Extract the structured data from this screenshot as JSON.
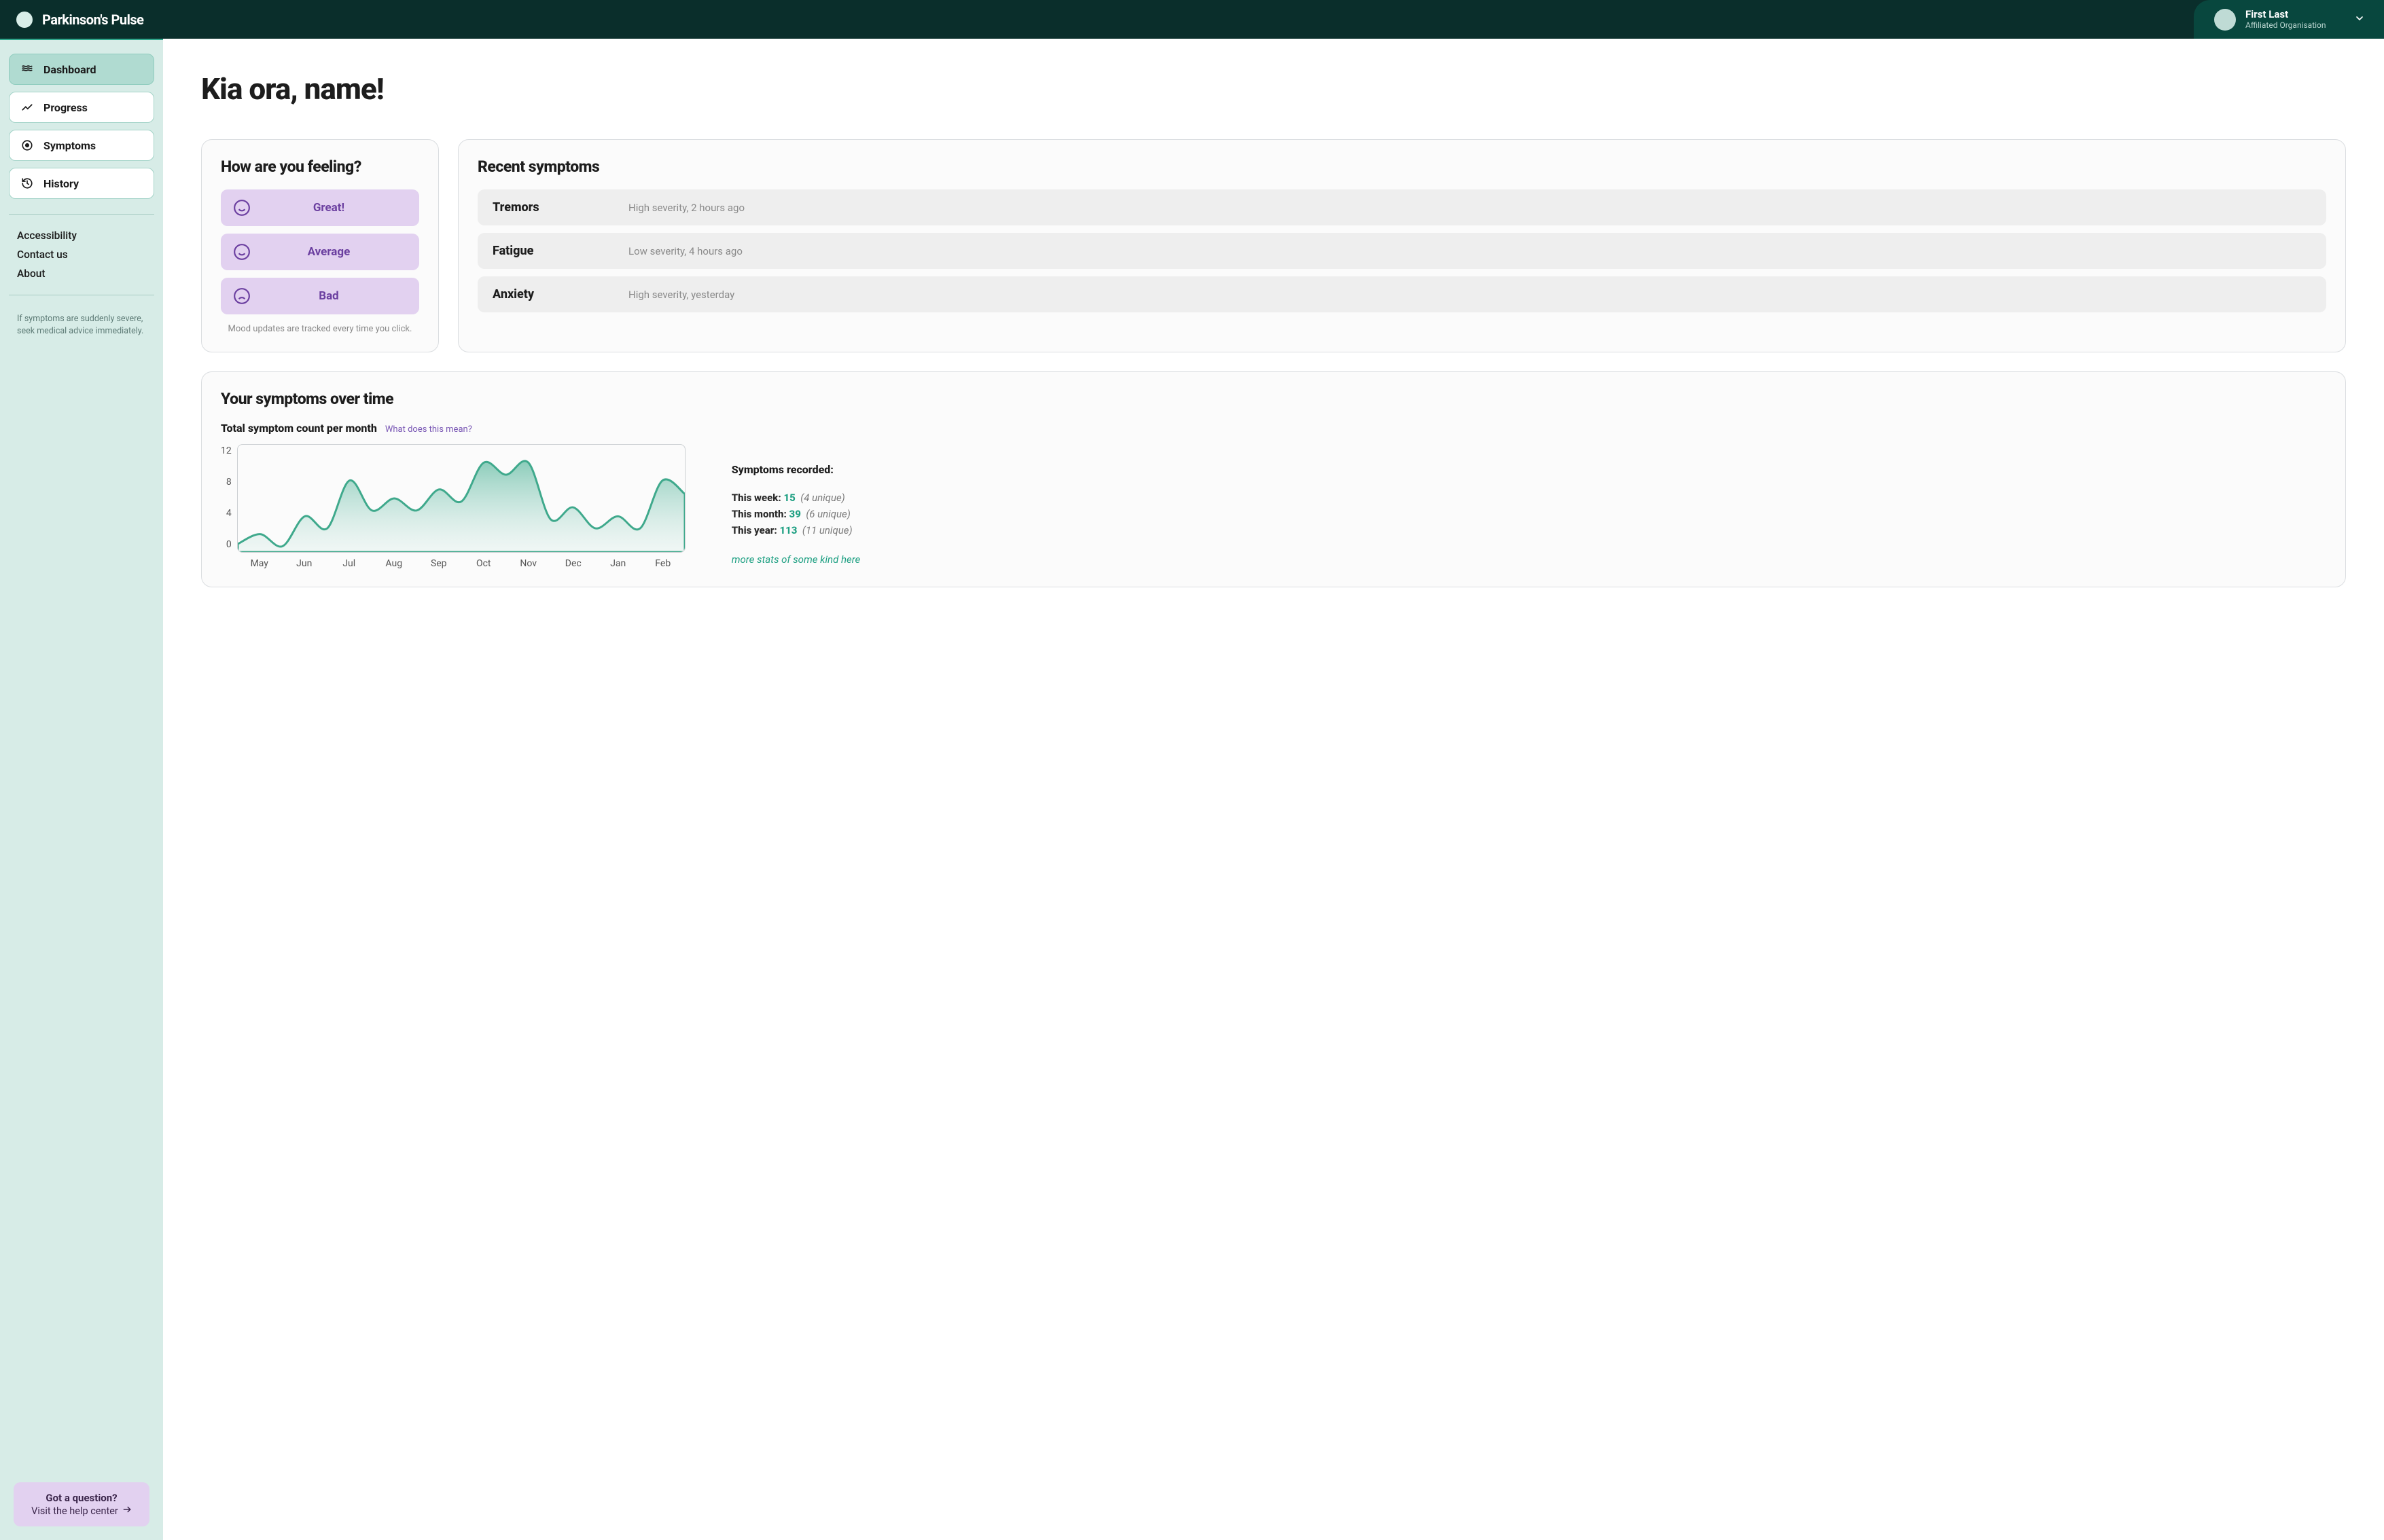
{
  "brand": {
    "name": "Parkinson's Pulse"
  },
  "user": {
    "name": "First Last",
    "org": "Affiliated Organisation"
  },
  "sidebar": {
    "items": [
      {
        "label": "Dashboard",
        "active": true
      },
      {
        "label": "Progress"
      },
      {
        "label": "Symptoms"
      },
      {
        "label": "History"
      }
    ],
    "secondary": [
      {
        "label": "Accessibility"
      },
      {
        "label": "Contact us"
      },
      {
        "label": "About"
      }
    ],
    "note": "If symptoms are suddenly severe, seek medical advice immediately.",
    "help": {
      "title": "Got a question?",
      "sub": "Visit the help center"
    }
  },
  "greeting": "Kia ora, name!",
  "feeling": {
    "title": "How are you feeling?",
    "options": [
      "Great!",
      "Average",
      "Bad"
    ],
    "note": "Mood updates are tracked every time you click."
  },
  "recent": {
    "title": "Recent symptoms",
    "items": [
      {
        "name": "Tremors",
        "meta": "High severity, 2 hours ago"
      },
      {
        "name": "Fatigue",
        "meta": "Low severity, 4 hours ago"
      },
      {
        "name": "Anxiety",
        "meta": "High severity, yesterday"
      }
    ]
  },
  "chart": {
    "title": "Your symptoms over time",
    "subtitle": "Total symptom count per month",
    "help_link": "What does this mean?",
    "stats_title": "Symptoms recorded:",
    "stats": [
      {
        "label": "This week:",
        "value": "15",
        "unique": "(4 unique)"
      },
      {
        "label": "This month:",
        "value": "39",
        "unique": "(6 unique)"
      },
      {
        "label": "This year:",
        "value": "113",
        "unique": "(11 unique)"
      }
    ],
    "more_link": "more stats of some kind here"
  },
  "chart_data": {
    "type": "area",
    "categories": [
      "May",
      "Jun",
      "Jul",
      "Aug",
      "Sep",
      "Oct",
      "Nov",
      "Dec",
      "Jan",
      "Feb"
    ],
    "values": [
      2,
      4,
      8,
      6,
      7,
      10,
      10,
      5,
      4,
      8
    ],
    "title": "Total symptom count per month",
    "xlabel": "",
    "ylabel": "",
    "ylim": [
      0,
      12
    ],
    "y_ticks": [
      12,
      8,
      4,
      0
    ]
  }
}
